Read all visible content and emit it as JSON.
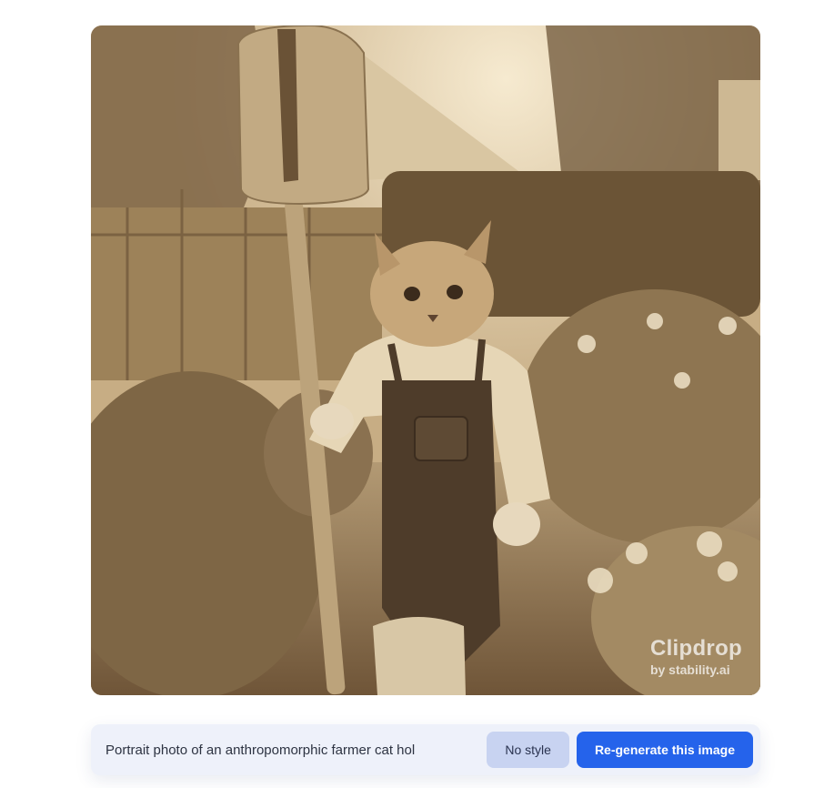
{
  "image": {
    "alt": "Portrait photo of an anthropomorphic farmer cat holding a shovel in a garden",
    "palette": {
      "sepia_light": "#e8d5b0",
      "sepia_mid": "#a98c63",
      "sepia_dark": "#5a4430"
    }
  },
  "watermark": {
    "brand": "Clipdrop",
    "byline": "by stability.ai"
  },
  "prompt_bar": {
    "prompt_text": "Portrait photo of an anthropomorphic farmer cat hol",
    "style_label": "No style",
    "regenerate_label": "Re-generate this image",
    "accent_color": "#2563eb"
  }
}
